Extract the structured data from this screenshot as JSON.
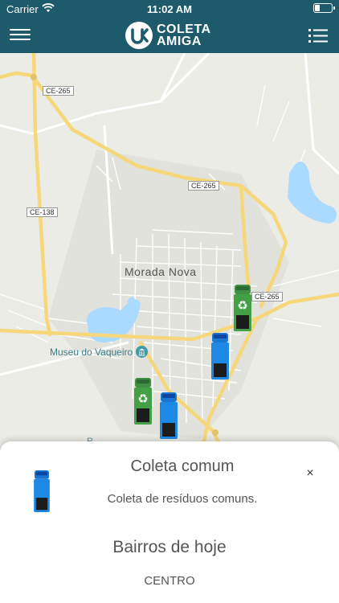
{
  "status_bar": {
    "carrier": "Carrier",
    "time": "11:02 AM",
    "battery_level": 0.3
  },
  "header": {
    "logo_line1": "COLETA",
    "logo_line2": "AMIGA",
    "menu_icon": "hamburger-menu-icon",
    "list_icon": "list-icon"
  },
  "map": {
    "city_label": "Morada Nova",
    "poi_label": "Museu do Vaqueiro",
    "partial_label": "R...",
    "road_labels": {
      "ce265_top": "CE-265",
      "ce265_mid": "CE-265",
      "ce265_right": "CE-265",
      "ce138": "CE-138"
    },
    "colors": {
      "highway": "#f6d77a",
      "water": "#aadaff",
      "recycling_truck": "#43a047",
      "common_truck": "#1e88e5"
    },
    "trucks": [
      {
        "type": "recycling"
      },
      {
        "type": "common"
      },
      {
        "type": "recycling"
      },
      {
        "type": "common"
      }
    ]
  },
  "sheet": {
    "title": "Coleta comum",
    "description": "Coleta de resíduos comuns.",
    "close_label": "×",
    "section_title": "Bairros de hoje",
    "neighborhoods": [
      "CENTRO"
    ]
  }
}
